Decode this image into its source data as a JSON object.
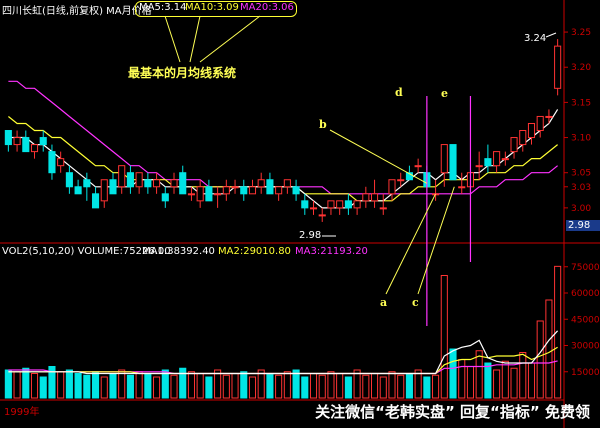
{
  "price_header": {
    "title": "四川长虹(日线,前复权) MA月价格",
    "ma5": "MA5:3.14",
    "ma10": "MA10:3.09",
    "ma20": "MA20:3.06"
  },
  "volume_header": {
    "vol": "VOL2(5,10,20) VOLUME:75226.00",
    "ma1": "MA1:38392.40",
    "ma2": "MA2:29010.80",
    "ma3": "MA3:21193.20"
  },
  "annotation_title": "最基本的月均线系统",
  "labels": {
    "a": "a",
    "b": "b",
    "c": "c",
    "d": "d",
    "e": "e"
  },
  "markers": {
    "low": "2.98",
    "high": "3.24",
    "current": "2.98"
  },
  "year_label": "1999年",
  "watermark": {
    "prefix": "关注微信",
    "mid1": "“老韩实盘”",
    "mid2": " 回复",
    "mid3": "“指标”",
    "suffix": " 免费领"
  },
  "colors": {
    "up": "#ff3333",
    "down": "#00e5e5",
    "ma5": "#ffffff",
    "ma10": "#ffff33",
    "ma20": "#ff33ff",
    "annotation": "#ffff55",
    "axis": "#cc0000"
  },
  "chart_data": [
    {
      "type": "candlestick",
      "ylim": [
        2.96,
        3.27
      ],
      "yticks": [
        3.25,
        3.2,
        3.15,
        3.1,
        3.05,
        3.03,
        3.0
      ],
      "series_names": [
        "MA5",
        "MA10",
        "MA20"
      ],
      "ohlc": [
        [
          3.11,
          3.11,
          3.08,
          3.09
        ],
        [
          3.09,
          3.11,
          3.08,
          3.1
        ],
        [
          3.1,
          3.11,
          3.08,
          3.08
        ],
        [
          3.08,
          3.09,
          3.07,
          3.09
        ],
        [
          3.1,
          3.11,
          3.08,
          3.09
        ],
        [
          3.08,
          3.09,
          3.04,
          3.05
        ],
        [
          3.06,
          3.08,
          3.05,
          3.07
        ],
        [
          3.05,
          3.06,
          3.02,
          3.03
        ],
        [
          3.03,
          3.04,
          3.02,
          3.02
        ],
        [
          3.04,
          3.05,
          3.01,
          3.03
        ],
        [
          3.02,
          3.03,
          3.0,
          3.0
        ],
        [
          3.01,
          3.04,
          3.0,
          3.04
        ],
        [
          3.04,
          3.05,
          3.02,
          3.02
        ],
        [
          3.03,
          3.06,
          3.02,
          3.06
        ],
        [
          3.05,
          3.06,
          3.02,
          3.03
        ],
        [
          3.03,
          3.05,
          3.02,
          3.05
        ],
        [
          3.04,
          3.05,
          3.02,
          3.03
        ],
        [
          3.03,
          3.05,
          3.02,
          3.04
        ],
        [
          3.02,
          3.03,
          3.0,
          3.01
        ],
        [
          3.03,
          3.05,
          3.02,
          3.04
        ],
        [
          3.05,
          3.06,
          3.02,
          3.02
        ],
        [
          3.02,
          3.03,
          3.01,
          3.02
        ],
        [
          3.01,
          3.04,
          3.0,
          3.03
        ],
        [
          3.03,
          3.04,
          3.01,
          3.01
        ],
        [
          3.02,
          3.03,
          3.0,
          3.02
        ],
        [
          3.02,
          3.04,
          3.01,
          3.03
        ],
        [
          3.03,
          3.04,
          3.02,
          3.03
        ],
        [
          3.03,
          3.04,
          3.01,
          3.02
        ],
        [
          3.02,
          3.04,
          3.02,
          3.03
        ],
        [
          3.03,
          3.05,
          3.02,
          3.04
        ],
        [
          3.04,
          3.05,
          3.02,
          3.02
        ],
        [
          3.02,
          3.03,
          3.01,
          3.03
        ],
        [
          3.03,
          3.04,
          3.02,
          3.04
        ],
        [
          3.03,
          3.04,
          3.01,
          3.02
        ],
        [
          3.01,
          3.02,
          2.99,
          3.0
        ],
        [
          3.0,
          3.01,
          2.99,
          3.0
        ],
        [
          2.99,
          3.0,
          2.98,
          2.99
        ],
        [
          3.0,
          3.01,
          2.99,
          3.01
        ],
        [
          3.0,
          3.01,
          2.99,
          3.01
        ],
        [
          3.01,
          3.02,
          2.99,
          3.0
        ],
        [
          3.0,
          3.01,
          2.99,
          3.01
        ],
        [
          3.01,
          3.03,
          3.0,
          3.02
        ],
        [
          3.01,
          3.04,
          3.0,
          3.02
        ],
        [
          3.0,
          3.02,
          2.99,
          3.0
        ],
        [
          3.02,
          3.04,
          3.01,
          3.04
        ],
        [
          3.04,
          3.05,
          3.03,
          3.04
        ],
        [
          3.05,
          3.06,
          3.04,
          3.04
        ],
        [
          3.06,
          3.07,
          3.05,
          3.06
        ],
        [
          3.05,
          3.06,
          3.03,
          3.03
        ],
        [
          3.02,
          3.04,
          3.01,
          3.02
        ],
        [
          3.05,
          3.09,
          3.03,
          3.09
        ],
        [
          3.09,
          3.09,
          3.04,
          3.04
        ],
        [
          3.03,
          3.05,
          3.02,
          3.03
        ],
        [
          3.03,
          3.05,
          3.02,
          3.05
        ],
        [
          3.06,
          3.08,
          3.04,
          3.06
        ],
        [
          3.07,
          3.09,
          3.05,
          3.06
        ],
        [
          3.06,
          3.08,
          3.05,
          3.08
        ],
        [
          3.07,
          3.08,
          3.06,
          3.07
        ],
        [
          3.08,
          3.1,
          3.07,
          3.1
        ],
        [
          3.09,
          3.11,
          3.08,
          3.11
        ],
        [
          3.1,
          3.12,
          3.09,
          3.12
        ],
        [
          3.11,
          3.13,
          3.1,
          3.13
        ],
        [
          3.13,
          3.14,
          3.12,
          3.13
        ],
        [
          3.17,
          3.24,
          3.16,
          3.23
        ]
      ],
      "ma5": [
        3.1,
        3.1,
        3.1,
        3.09,
        3.09,
        3.08,
        3.07,
        3.06,
        3.05,
        3.04,
        3.03,
        3.03,
        3.03,
        3.03,
        3.03,
        3.04,
        3.04,
        3.04,
        3.03,
        3.03,
        3.03,
        3.03,
        3.02,
        3.02,
        3.02,
        3.02,
        3.03,
        3.03,
        3.03,
        3.03,
        3.03,
        3.03,
        3.03,
        3.03,
        3.02,
        3.01,
        3.0,
        3.0,
        3.0,
        3.0,
        3.01,
        3.01,
        3.01,
        3.01,
        3.02,
        3.03,
        3.04,
        3.05,
        3.05,
        3.04,
        3.05,
        3.05,
        3.04,
        3.05,
        3.05,
        3.06,
        3.06,
        3.07,
        3.08,
        3.09,
        3.1,
        3.11,
        3.12,
        3.14
      ],
      "ma10": [
        3.13,
        3.12,
        3.12,
        3.11,
        3.11,
        3.1,
        3.1,
        3.09,
        3.08,
        3.07,
        3.06,
        3.06,
        3.05,
        3.05,
        3.04,
        3.04,
        3.04,
        3.04,
        3.04,
        3.03,
        3.03,
        3.03,
        3.03,
        3.03,
        3.03,
        3.03,
        3.03,
        3.03,
        3.03,
        3.03,
        3.03,
        3.03,
        3.03,
        3.03,
        3.02,
        3.02,
        3.02,
        3.02,
        3.02,
        3.02,
        3.01,
        3.01,
        3.01,
        3.01,
        3.01,
        3.02,
        3.02,
        3.03,
        3.03,
        3.03,
        3.04,
        3.04,
        3.04,
        3.04,
        3.04,
        3.05,
        3.05,
        3.05,
        3.06,
        3.06,
        3.07,
        3.07,
        3.08,
        3.09
      ],
      "ma20": [
        3.18,
        3.18,
        3.17,
        3.17,
        3.16,
        3.15,
        3.14,
        3.13,
        3.12,
        3.11,
        3.1,
        3.09,
        3.08,
        3.07,
        3.06,
        3.06,
        3.05,
        3.05,
        3.04,
        3.04,
        3.04,
        3.04,
        3.04,
        3.03,
        3.03,
        3.03,
        3.03,
        3.03,
        3.03,
        3.03,
        3.03,
        3.03,
        3.03,
        3.03,
        3.03,
        3.03,
        3.03,
        3.02,
        3.02,
        3.02,
        3.02,
        3.02,
        3.02,
        3.02,
        3.02,
        3.02,
        3.02,
        3.02,
        3.02,
        3.02,
        3.02,
        3.02,
        3.02,
        3.02,
        3.03,
        3.03,
        3.03,
        3.04,
        3.04,
        3.04,
        3.05,
        3.05,
        3.05,
        3.06
      ]
    },
    {
      "type": "bar",
      "title": "VOL2(5,10,20)",
      "ylim": [
        0,
        80000
      ],
      "yticks": [
        75000,
        60000,
        45000,
        30000,
        15000
      ],
      "series_names": [
        "VOLUME",
        "MA1",
        "MA2",
        "MA3"
      ],
      "values": [
        16000,
        15000,
        17000,
        14000,
        12000,
        18000,
        15000,
        16000,
        14000,
        13000,
        15000,
        12000,
        14000,
        16000,
        13000,
        15000,
        14000,
        12000,
        16000,
        13000,
        17000,
        15000,
        14000,
        12000,
        16000,
        13000,
        14000,
        15000,
        12000,
        16000,
        14000,
        13000,
        15000,
        16000,
        12000,
        14000,
        13000,
        15000,
        14000,
        12000,
        16000,
        13000,
        14000,
        12000,
        15000,
        13000,
        14000,
        16000,
        12000,
        13000,
        70000,
        28000,
        22000,
        18000,
        27000,
        20000,
        16000,
        21000,
        17000,
        26000,
        20000,
        44000,
        56000,
        75226
      ],
      "ma1": [
        15000,
        15000,
        15000,
        15000,
        15000,
        15000,
        15000,
        15000,
        15000,
        14000,
        14000,
        14000,
        14000,
        14000,
        14000,
        14000,
        14000,
        14000,
        14000,
        14000,
        14000,
        14000,
        14000,
        14000,
        14000,
        14000,
        14000,
        14000,
        14000,
        14000,
        14000,
        14000,
        14000,
        14000,
        14000,
        14000,
        14000,
        14000,
        14000,
        14000,
        14000,
        14000,
        14000,
        14000,
        14000,
        14000,
        14000,
        14000,
        14000,
        14000,
        24000,
        27000,
        29000,
        30000,
        33000,
        23000,
        21000,
        20000,
        20000,
        20000,
        20000,
        26000,
        33000,
        38392
      ],
      "ma2": [
        15000,
        15000,
        15000,
        15000,
        15000,
        15000,
        15000,
        15000,
        15000,
        15000,
        15000,
        15000,
        15000,
        15000,
        15000,
        14000,
        14000,
        14000,
        14000,
        14000,
        14000,
        14000,
        14000,
        14000,
        14000,
        14000,
        14000,
        14000,
        14000,
        14000,
        14000,
        14000,
        14000,
        14000,
        14000,
        14000,
        14000,
        14000,
        14000,
        14000,
        14000,
        14000,
        14000,
        14000,
        14000,
        14000,
        14000,
        14000,
        14000,
        14000,
        19000,
        21000,
        22000,
        22000,
        24000,
        23000,
        24000,
        24000,
        24000,
        25000,
        22000,
        24000,
        26000,
        29011
      ],
      "ma3": [
        16000,
        16000,
        16000,
        16000,
        16000,
        15000,
        15000,
        15000,
        15000,
        15000,
        15000,
        15000,
        15000,
        15000,
        15000,
        15000,
        15000,
        15000,
        15000,
        14000,
        14000,
        14000,
        14000,
        14000,
        14000,
        14000,
        14000,
        14000,
        14000,
        14000,
        14000,
        14000,
        14000,
        14000,
        14000,
        14000,
        14000,
        14000,
        14000,
        14000,
        14000,
        14000,
        14000,
        14000,
        14000,
        14000,
        14000,
        14000,
        14000,
        14000,
        17000,
        17000,
        18000,
        18000,
        18000,
        18000,
        19000,
        19000,
        19000,
        20000,
        20000,
        20000,
        20000,
        21193
      ]
    }
  ]
}
